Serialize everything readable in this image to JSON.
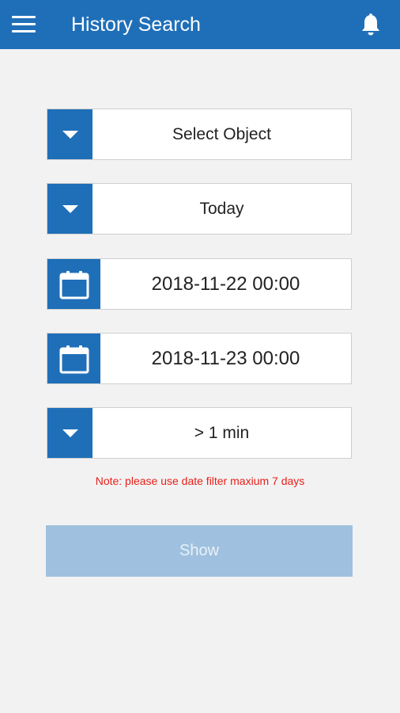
{
  "app": {
    "title": "History Search",
    "theme_color": "#1f6fb8",
    "menu_icon": "hamburger-menu-icon",
    "notification_icon": "bell-icon"
  },
  "form": {
    "object_select": {
      "value": "Select Object",
      "icon": "chevron-down-icon"
    },
    "range_select": {
      "value": "Today",
      "icon": "chevron-down-icon"
    },
    "start_date": {
      "value": "2018-11-22 00:00",
      "icon": "calendar-icon"
    },
    "end_date": {
      "value": "2018-11-23 00:00",
      "icon": "calendar-icon"
    },
    "duration_select": {
      "value": "> 1 min",
      "icon": "chevron-down-icon"
    },
    "note": "Note: please use date filter maxium 7 days",
    "note_color": "#e8201a",
    "show_button": {
      "label": "Show",
      "color": "#9fc1df"
    }
  }
}
